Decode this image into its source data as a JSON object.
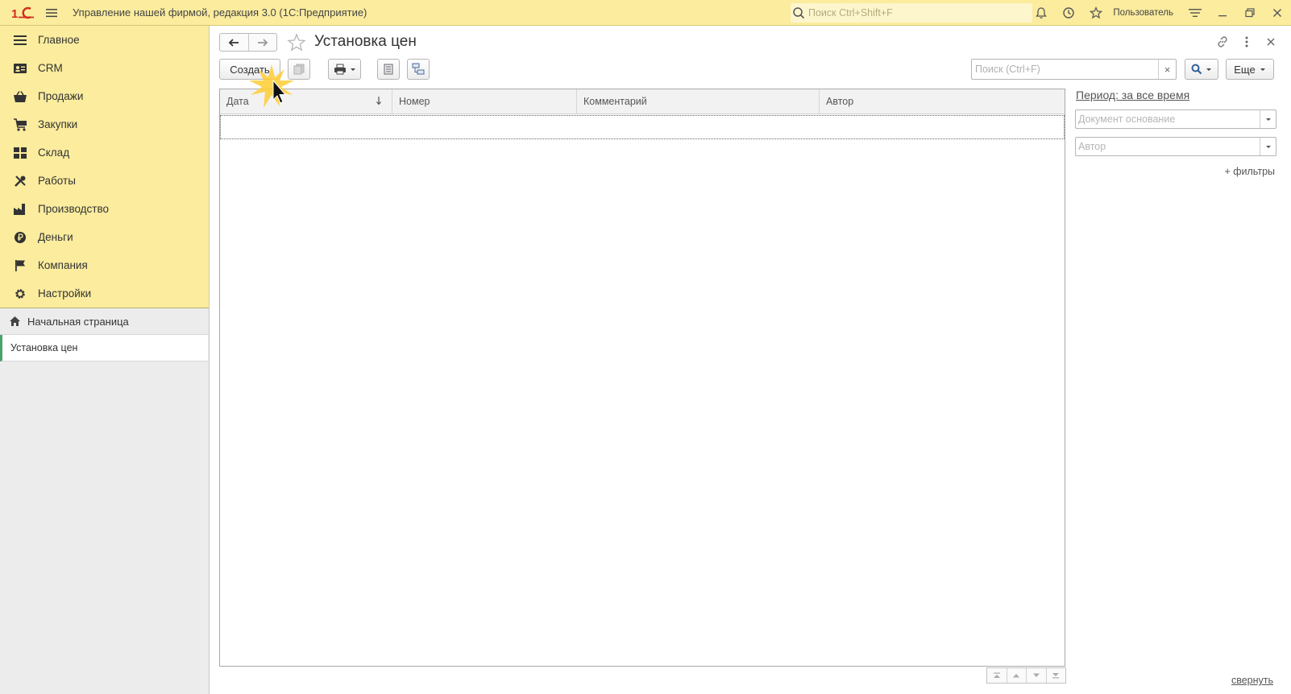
{
  "titlebar": {
    "app_title": "Управление нашей фирмой, редакция 3.0  (1С:Предприятие)",
    "search_placeholder": "Поиск Ctrl+Shift+F",
    "user": "Пользователь"
  },
  "sidebar": {
    "sections": [
      {
        "label": "Главное",
        "icon": "menu-lines-icon"
      },
      {
        "label": "CRM",
        "icon": "contact-card-icon"
      },
      {
        "label": "Продажи",
        "icon": "shopping-basket-icon"
      },
      {
        "label": "Закупки",
        "icon": "cart-icon"
      },
      {
        "label": "Склад",
        "icon": "warehouse-grid-icon"
      },
      {
        "label": "Работы",
        "icon": "tools-icon"
      },
      {
        "label": "Производство",
        "icon": "factory-icon"
      },
      {
        "label": "Деньги",
        "icon": "ruble-coin-icon"
      },
      {
        "label": "Компания",
        "icon": "flag-icon"
      },
      {
        "label": "Настройки",
        "icon": "gear-icon"
      }
    ],
    "home": "Начальная страница",
    "open_windows": [
      "Установка цен"
    ]
  },
  "page": {
    "title": "Установка цен",
    "toolbar": {
      "create": "Создать",
      "search_placeholder": "Поиск (Ctrl+F)",
      "clear": "×",
      "more": "Еще"
    },
    "table": {
      "columns": [
        "Дата",
        "Номер",
        "Комментарий",
        "Автор"
      ],
      "rows": []
    },
    "filters": {
      "period": "Период: за все время",
      "doc_base_placeholder": "Документ основание",
      "author_placeholder": "Автор",
      "add_filters": "+ фильтры"
    },
    "collapse": "свернуть"
  },
  "colors": {
    "titlebar_bg": "#fbec9e",
    "sidebar_bg": "#ececec",
    "active_marker": "#4aa36a",
    "logo_red": "#d52b1e"
  }
}
